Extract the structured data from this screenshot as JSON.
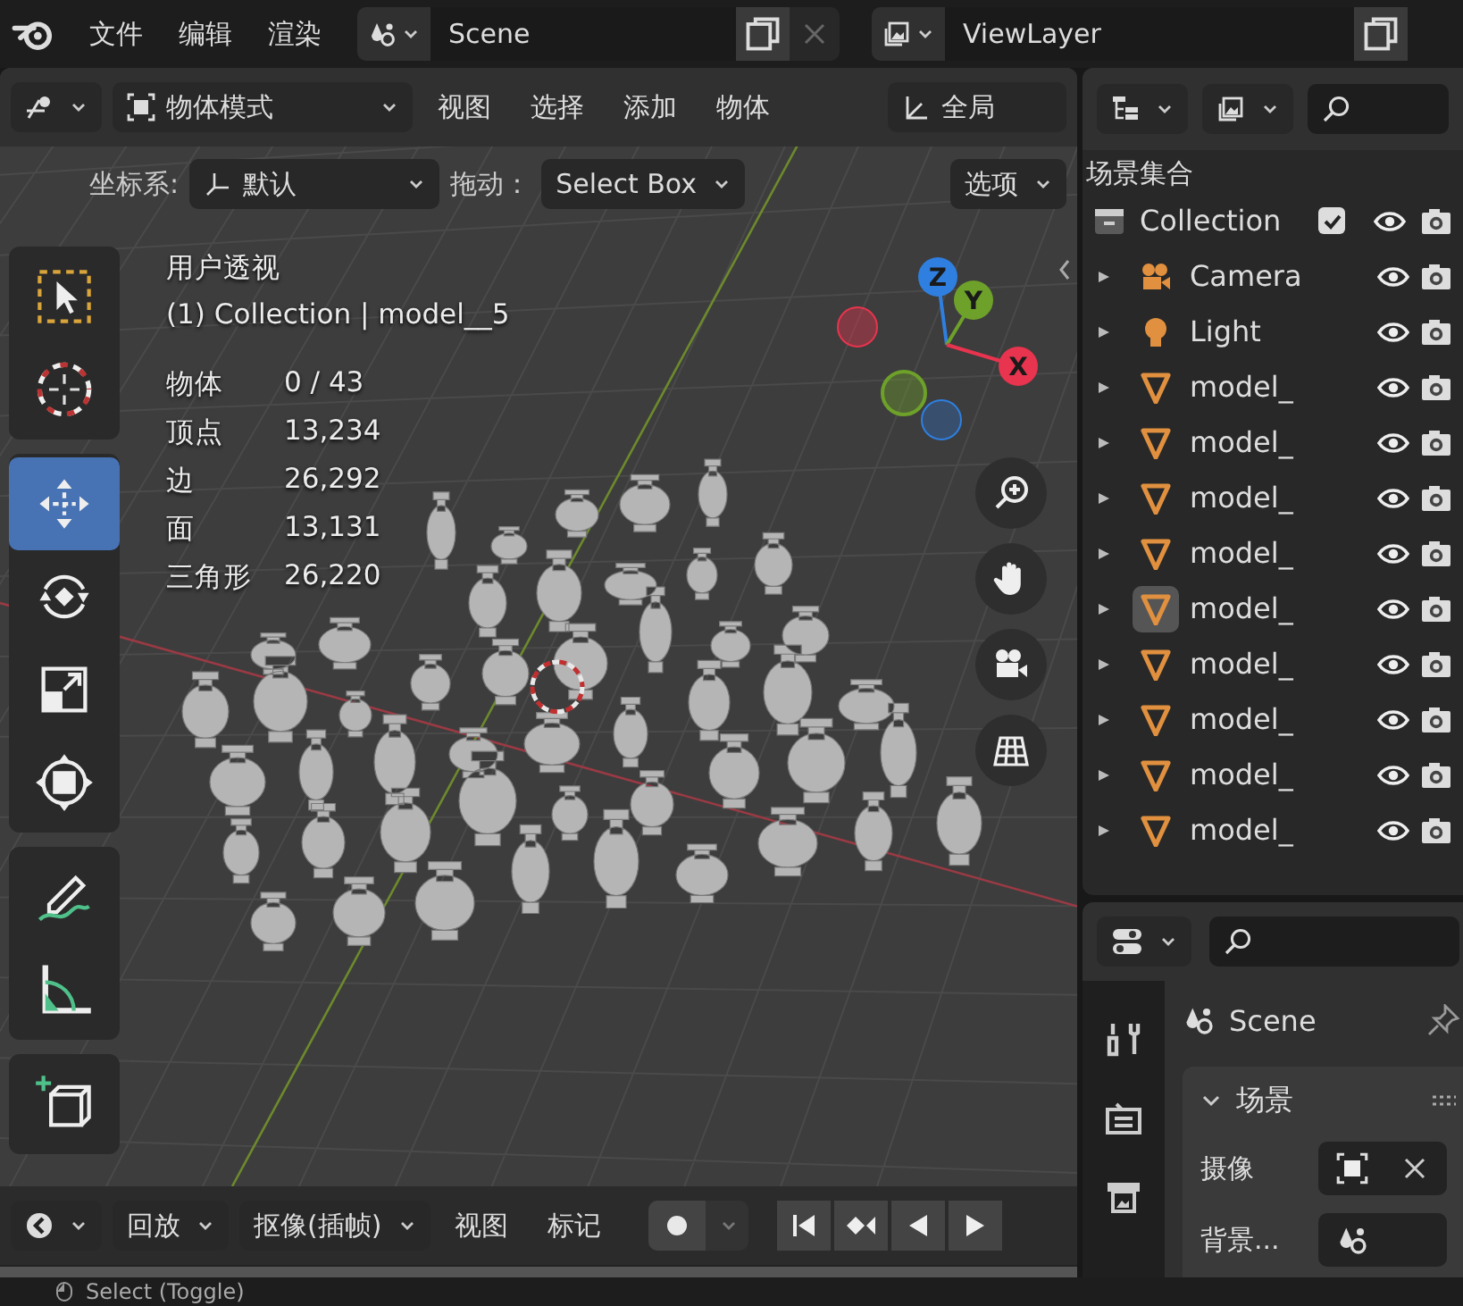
{
  "topbar": {
    "menus": [
      "文件",
      "编辑",
      "渲染"
    ],
    "scene": "Scene",
    "view_layer": "ViewLayer"
  },
  "viewport": {
    "mode": "物体模式",
    "menus": [
      "视图",
      "选择",
      "添加",
      "物体"
    ],
    "transform": "全局",
    "orientation_label": "坐标系:",
    "orientation": "默认",
    "drag_label": "拖动：",
    "drag": "Select Box",
    "options": "选项",
    "tools": [
      {
        "kind": "select",
        "selected": false
      },
      {
        "kind": "cursor",
        "selected": false
      },
      {
        "kind": "move",
        "selected": true
      },
      {
        "kind": "rotate",
        "selected": false
      },
      {
        "kind": "scale",
        "selected": false
      },
      {
        "kind": "transform",
        "selected": false
      },
      {
        "kind": "annotate",
        "selected": false
      },
      {
        "kind": "measure",
        "selected": false
      },
      {
        "kind": "add_cube",
        "selected": false
      }
    ],
    "view_name": "用户透视",
    "context": "(1) Collection | model__5",
    "stats": [
      {
        "label": "物体",
        "value": "0 / 43"
      },
      {
        "label": "顶点",
        "value": "13,234"
      },
      {
        "label": "边",
        "value": "26,292"
      },
      {
        "label": "面",
        "value": "13,131"
      },
      {
        "label": "三角形",
        "value": "26,220"
      }
    ],
    "gizmo": [
      {
        "label": "Z",
        "color": "#2f7fe0"
      },
      {
        "label": "Y",
        "color": "#6ea12a"
      },
      {
        "label": "X",
        "color": "#e8344e"
      }
    ]
  },
  "outliner": {
    "title": "场景集合",
    "collection": {
      "name": "Collection",
      "checked": true
    },
    "items": [
      {
        "name": "Camera",
        "kind": "camera",
        "selected": false
      },
      {
        "name": "Light",
        "kind": "light",
        "selected": false
      },
      {
        "name": "model_",
        "kind": "mesh",
        "selected": false
      },
      {
        "name": "model_",
        "kind": "mesh",
        "selected": false
      },
      {
        "name": "model_",
        "kind": "mesh",
        "selected": false
      },
      {
        "name": "model_",
        "kind": "mesh",
        "selected": false
      },
      {
        "name": "model_",
        "kind": "mesh",
        "selected": true
      },
      {
        "name": "model_",
        "kind": "mesh",
        "selected": false
      },
      {
        "name": "model_",
        "kind": "mesh",
        "selected": false
      },
      {
        "name": "model_",
        "kind": "mesh",
        "selected": false
      },
      {
        "name": "model_",
        "kind": "mesh",
        "selected": false
      }
    ]
  },
  "properties": {
    "scene": "Scene",
    "panel": {
      "title": "场景",
      "expanded": true
    },
    "fields": [
      {
        "label": "摄像",
        "kind": "camera"
      },
      {
        "label": "背景...",
        "kind": "scene"
      }
    ]
  },
  "timeline": {
    "menus": [
      {
        "label": "回放",
        "dropdown": true
      },
      {
        "label": "抠像(插帧)",
        "dropdown": true
      },
      {
        "label": "视图",
        "dropdown": false
      },
      {
        "label": "标记",
        "dropdown": false
      }
    ]
  },
  "status_bar": {
    "text": "Select (Toggle)"
  }
}
